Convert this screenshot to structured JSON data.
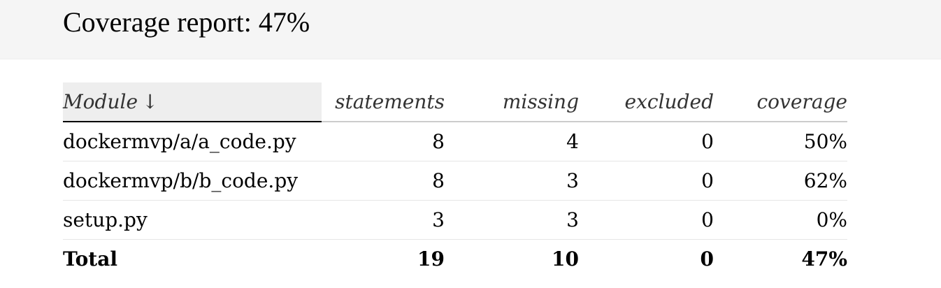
{
  "header": {
    "title": "Coverage report: 47%"
  },
  "table": {
    "columns": {
      "module": "Module",
      "statements": "statements",
      "missing": "missing",
      "excluded": "excluded",
      "coverage": "coverage"
    },
    "sort_indicator": "↓",
    "rows": [
      {
        "module": "dockermvp/a/a_code.py",
        "statements": "8",
        "missing": "4",
        "excluded": "0",
        "coverage": "50%"
      },
      {
        "module": "dockermvp/b/b_code.py",
        "statements": "8",
        "missing": "3",
        "excluded": "0",
        "coverage": "62%"
      },
      {
        "module": "setup.py",
        "statements": "3",
        "missing": "3",
        "excluded": "0",
        "coverage": "0%"
      }
    ],
    "total": {
      "label": "Total",
      "statements": "19",
      "missing": "10",
      "excluded": "0",
      "coverage": "47%"
    }
  }
}
